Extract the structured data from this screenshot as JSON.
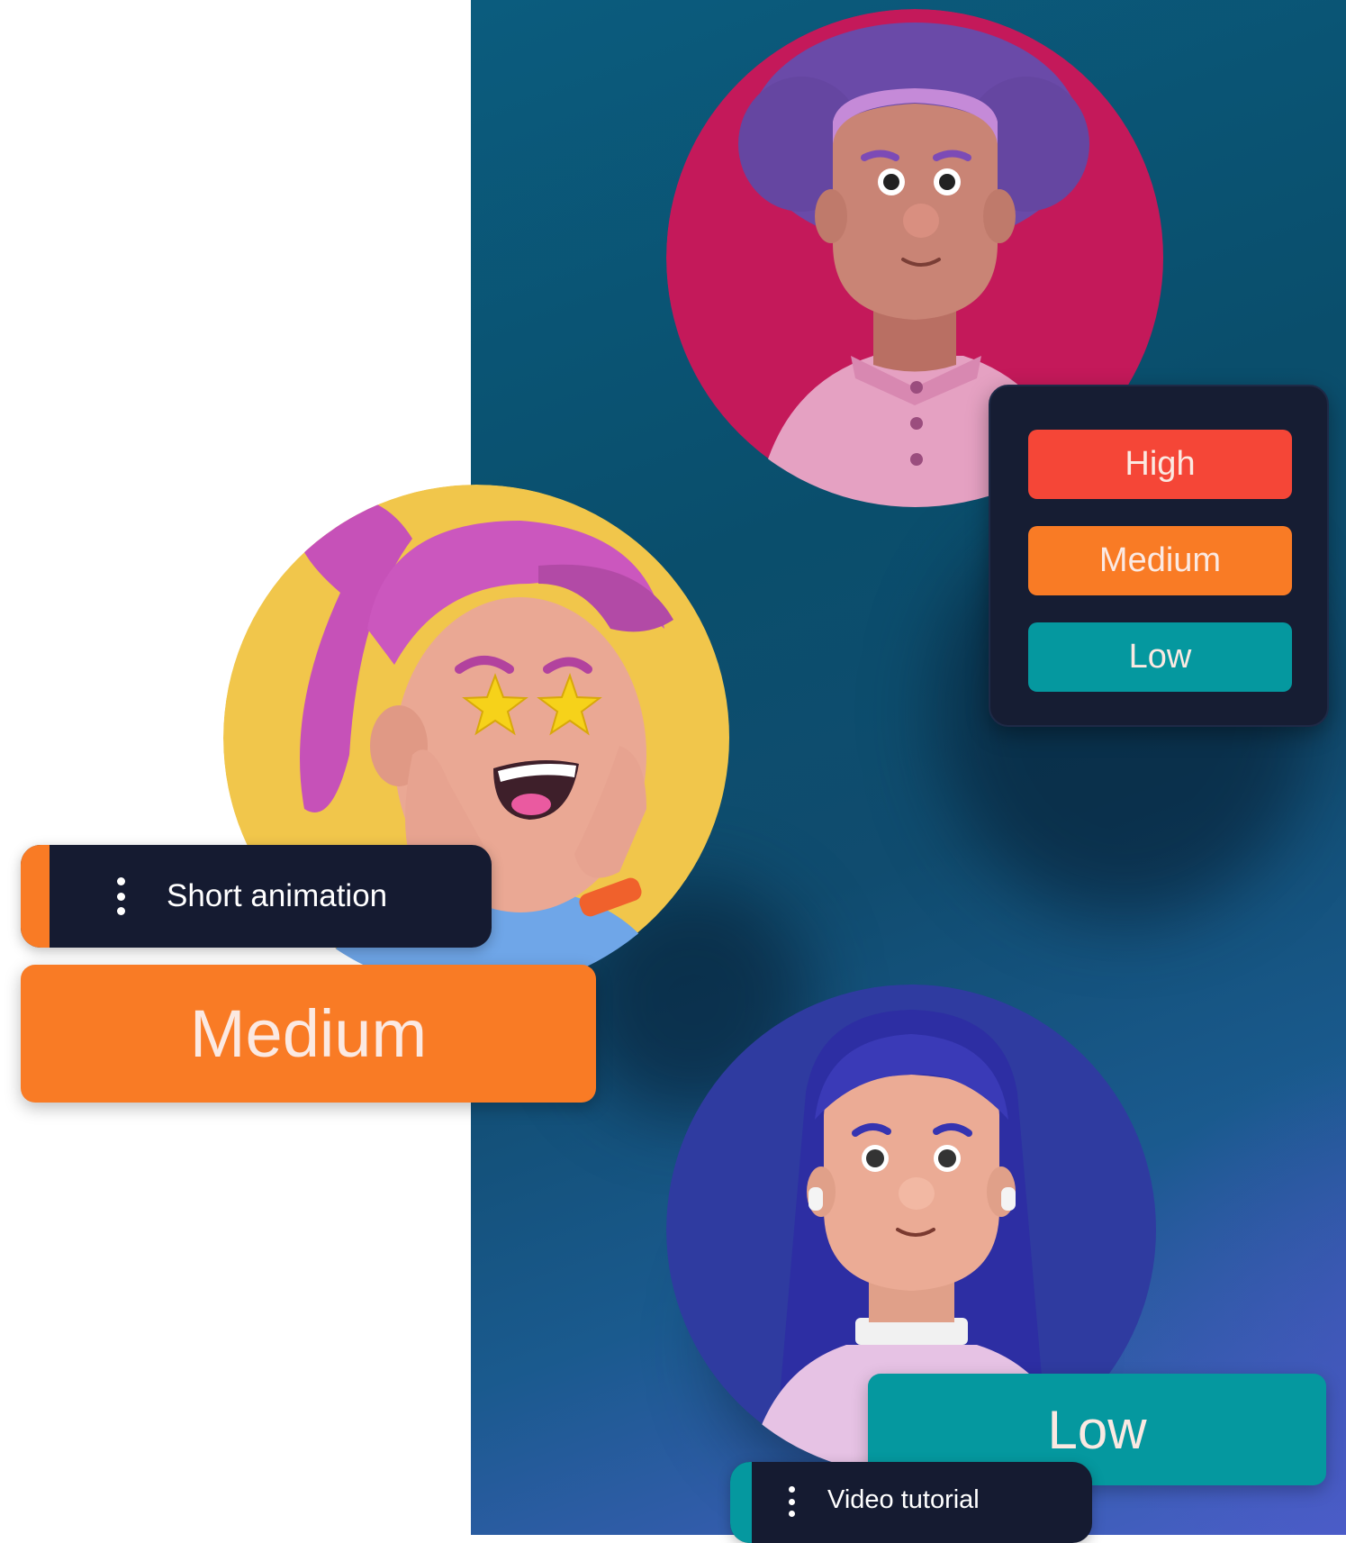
{
  "priority_menu": {
    "options": [
      {
        "label": "High",
        "color": "#f54637"
      },
      {
        "label": "Medium",
        "color": "#f97b25"
      },
      {
        "label": "Low",
        "color": "#05989f"
      }
    ]
  },
  "tasks": [
    {
      "label": "Short animation",
      "accent": "#f97b25",
      "icon": "vertical-dots-icon"
    },
    {
      "label": "Video tutorial",
      "accent": "#05989f",
      "icon": "vertical-dots-icon"
    }
  ],
  "badges": {
    "medium": {
      "label": "Medium",
      "color": "#f97b25"
    },
    "low": {
      "label": "Low",
      "color": "#05989f"
    }
  },
  "avatars": [
    {
      "name": "man-avatar",
      "circle_color": "#c4195a"
    },
    {
      "name": "starry-eyed-woman-avatar",
      "circle_color": "#f1c64b"
    },
    {
      "name": "woman-avatar",
      "circle_color": "#2f3ba0"
    }
  ]
}
